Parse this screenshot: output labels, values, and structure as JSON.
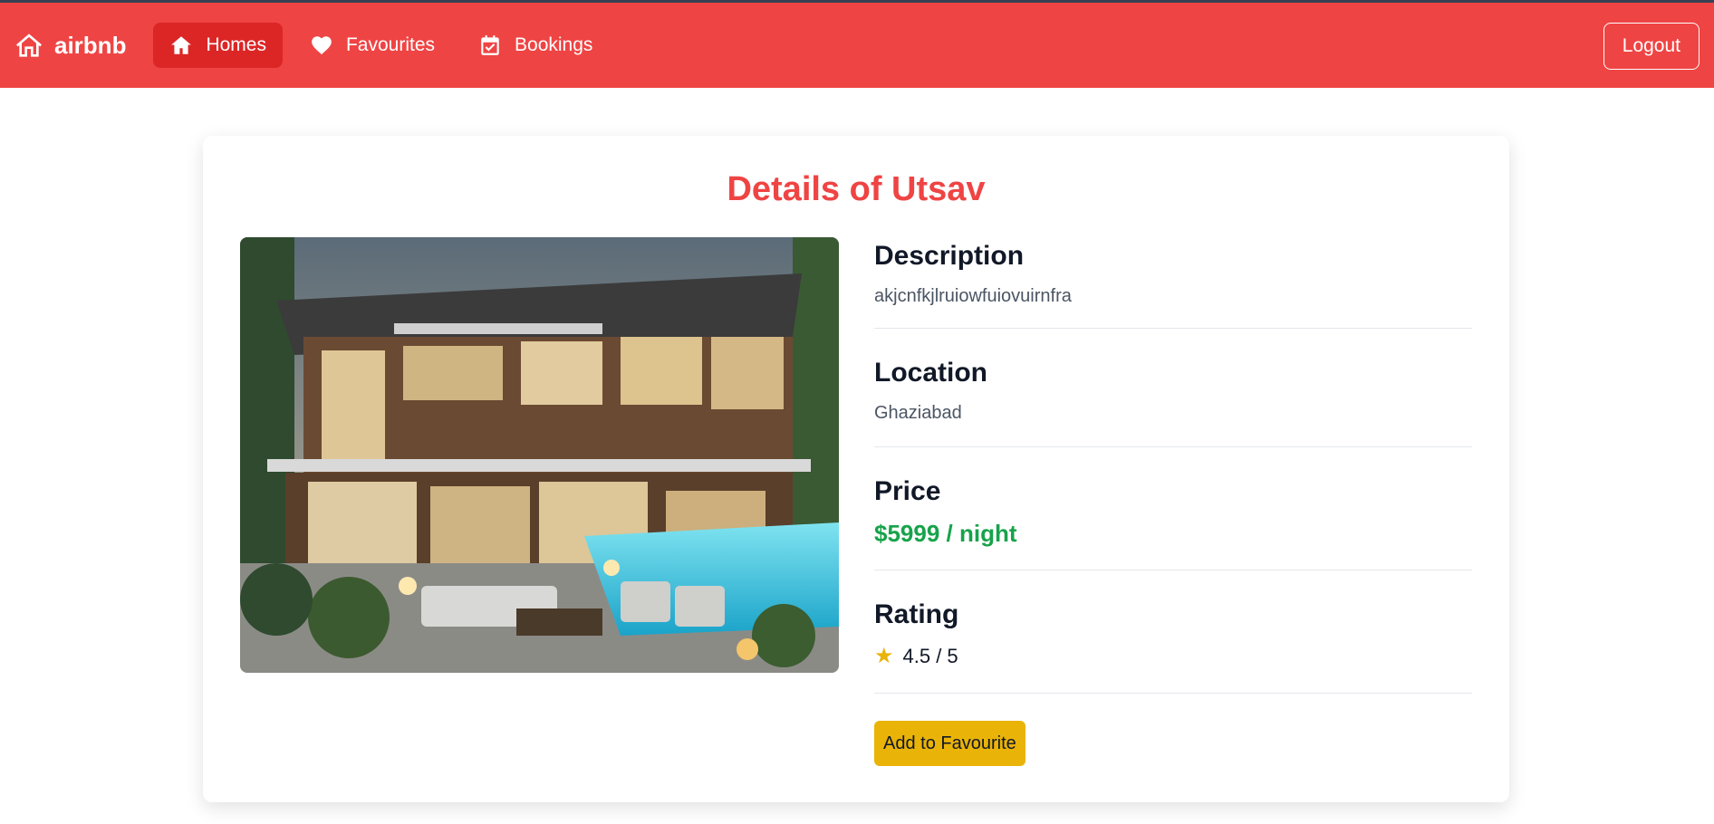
{
  "nav": {
    "brand": "airbnb",
    "items": [
      {
        "label": "Homes",
        "icon": "home-icon",
        "active": true
      },
      {
        "label": "Favourites",
        "icon": "heart-icon",
        "active": false
      },
      {
        "label": "Bookings",
        "icon": "calendar-check-icon",
        "active": false
      }
    ],
    "logout_label": "Logout"
  },
  "details": {
    "title": "Details of Utsav",
    "description_heading": "Description",
    "description": "akjcnfkjlruiowfuiovuirnfra",
    "location_heading": "Location",
    "location": "Ghaziabad",
    "price_heading": "Price",
    "price": "$5999 / night",
    "rating_heading": "Rating",
    "rating": "4.5 / 5",
    "rating_value": 4.5,
    "favourite_button": "Add to Favourite"
  },
  "colors": {
    "brand": "#ef4444",
    "brand_dark": "#dc2626",
    "price": "#16a34a",
    "accent": "#eab308"
  }
}
